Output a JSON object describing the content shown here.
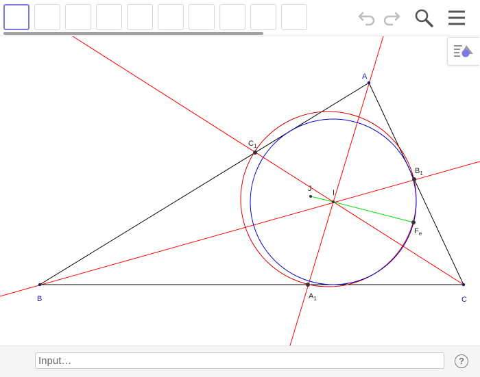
{
  "toolbar": {
    "tools": [
      {
        "name": "tool-move",
        "active": true
      },
      {
        "name": "tool-point",
        "active": false
      },
      {
        "name": "tool-line",
        "active": false
      },
      {
        "name": "tool-perpendicular",
        "active": false
      },
      {
        "name": "tool-polygon",
        "active": false
      },
      {
        "name": "tool-circle",
        "active": false
      },
      {
        "name": "tool-ellipse",
        "active": false
      },
      {
        "name": "tool-angle",
        "active": false
      },
      {
        "name": "tool-reflect",
        "active": false
      },
      {
        "name": "tool-slider",
        "active": false
      }
    ],
    "icons": [
      "undo-icon",
      "redo-icon",
      "search-icon",
      "menu-icon"
    ]
  },
  "graphics": {
    "points": {
      "A": {
        "label": "A"
      },
      "B": {
        "label": "B"
      },
      "C": {
        "label": "C"
      },
      "A1": {
        "label": "A",
        "sub": "1"
      },
      "B1": {
        "label": "B",
        "sub": "1"
      },
      "C1": {
        "label": "C",
        "sub": "1"
      },
      "I": {
        "label": "I"
      },
      "J": {
        "label": "J"
      },
      "Fe": {
        "label": "F",
        "sub": "e"
      }
    },
    "colors": {
      "triangle": "#000000",
      "bisector": "#ff0000",
      "circumcircle_cevian": "#d40000",
      "incircle": "#0000cc",
      "segment": "#00dd00",
      "point_label": "#1a1aaa"
    }
  },
  "input": {
    "placeholder": "Input…"
  },
  "help": {
    "label": "?"
  }
}
